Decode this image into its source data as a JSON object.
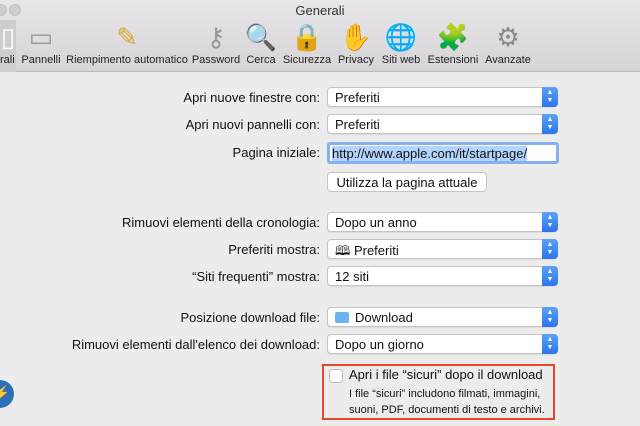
{
  "window": {
    "title": "Generali"
  },
  "toolbar": [
    {
      "label": "rali",
      "icon": "general-icon",
      "glyph": "▯"
    },
    {
      "label": "Pannelli",
      "icon": "tabs-icon",
      "glyph": "▭"
    },
    {
      "label": "Riempimento automatico",
      "icon": "autofill-pencil-icon",
      "glyph": "✎"
    },
    {
      "label": "Password",
      "icon": "key-icon",
      "glyph": "⚷"
    },
    {
      "label": "Cerca",
      "icon": "magnifier-icon",
      "glyph": "🔍"
    },
    {
      "label": "Sicurezza",
      "icon": "padlock-icon",
      "glyph": "🔒"
    },
    {
      "label": "Privacy",
      "icon": "hand-icon",
      "glyph": "✋"
    },
    {
      "label": "Siti web",
      "icon": "globe-icon",
      "glyph": "🌐"
    },
    {
      "label": "Estensioni",
      "icon": "puzzle-compass-icon",
      "glyph": "🧩"
    },
    {
      "label": "Avanzate",
      "icon": "gear-icon",
      "glyph": "⚙"
    }
  ],
  "form": {
    "new_windows": {
      "label": "Apri nuove finestre con:",
      "value": "Preferiti"
    },
    "new_tabs": {
      "label": "Apri nuovi pannelli con:",
      "value": "Preferiti"
    },
    "homepage": {
      "label": "Pagina iniziale:",
      "value": "http://www.apple.com/it/startpage/"
    },
    "use_current": "Utilizza la pagina attuale",
    "history": {
      "label": "Rimuovi elementi della cronologia:",
      "value": "Dopo un anno"
    },
    "favorites": {
      "label": "Preferiti mostra:",
      "value": "Preferiti"
    },
    "top_sites": {
      "label": "“Siti frequenti” mostra:",
      "value": "12 siti"
    },
    "download_location": {
      "label": "Posizione download file:",
      "value": "Download"
    },
    "download_remove": {
      "label": "Rimuovi elementi dall'elenco dei download:",
      "value": "Dopo un giorno"
    },
    "safe_files": {
      "label": "Apri i file “sicuri” dopo il download",
      "checked": false,
      "desc1": "I file “sicuri” includono filmati, immagini,",
      "desc2": "suoni, PDF, documenti di testo e archivi."
    }
  },
  "colors": {
    "accent": "#2a74ef",
    "highlight": "#e8472c"
  }
}
